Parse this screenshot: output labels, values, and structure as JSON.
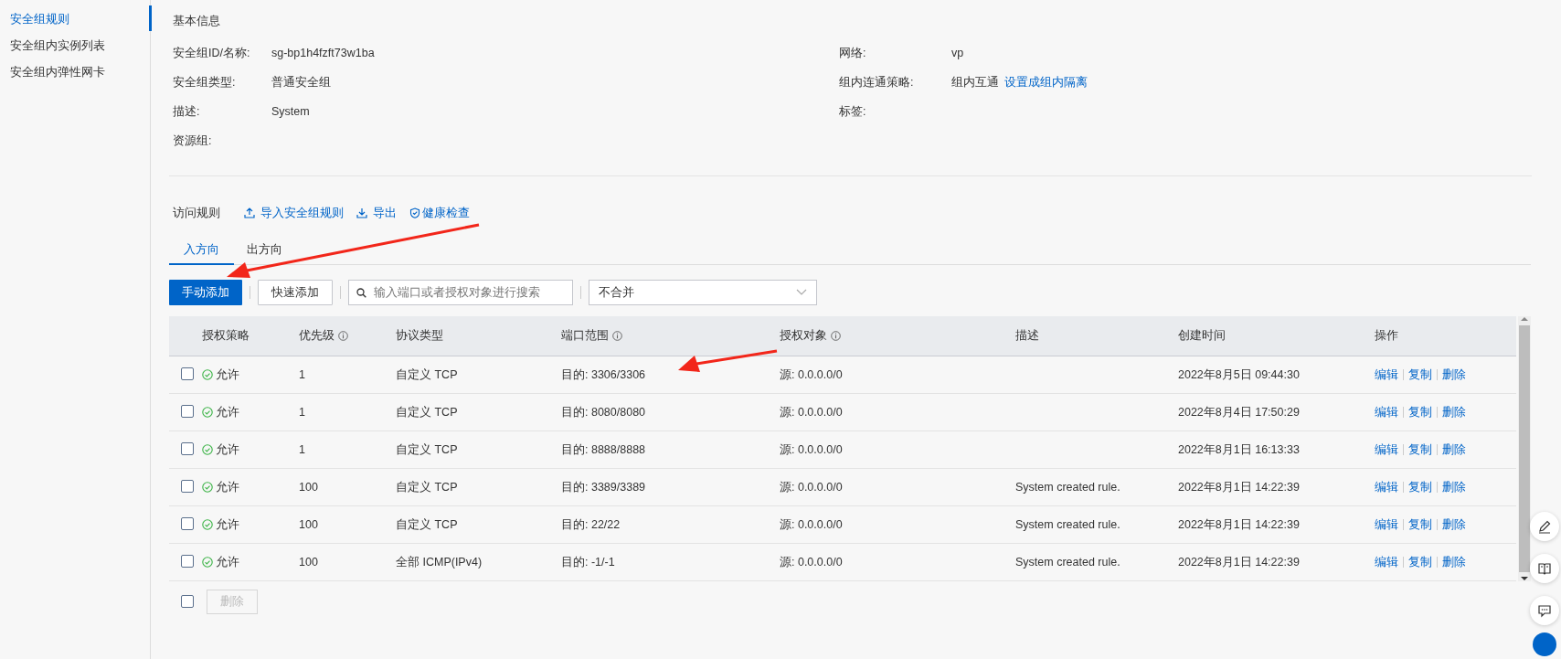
{
  "sidebar": {
    "items": [
      {
        "label": "安全组规则",
        "selected": true
      },
      {
        "label": "安全组内实例列表",
        "selected": false
      },
      {
        "label": "安全组内弹性网卡",
        "selected": false
      }
    ]
  },
  "basic_info": {
    "title": "基本信息",
    "left": [
      {
        "label": "安全组ID/名称:",
        "value": "sg-bp1h4fzft73w1ba"
      },
      {
        "label": "安全组类型:",
        "value": "普通安全组"
      },
      {
        "label": "描述:",
        "value": "System"
      },
      {
        "label": "资源组:"
      }
    ],
    "right": [
      {
        "label": "网络:",
        "value": "vp"
      },
      {
        "label": "组内连通策略:",
        "value": "组内互通",
        "link": "设置成组内隔离"
      },
      {
        "label": "标签:"
      }
    ]
  },
  "access_rules": {
    "title": "访问规则",
    "actions": [
      {
        "label": "导入安全组规则",
        "kind": "upload"
      },
      {
        "label": "导出",
        "kind": "download"
      },
      {
        "label": "健康检查",
        "kind": "shield"
      }
    ]
  },
  "tabs": [
    {
      "label": "入方向",
      "selected": true
    },
    {
      "label": "出方向",
      "selected": false
    }
  ],
  "toolbar": {
    "primary_button": "手动添加",
    "secondary_button": "快速添加",
    "search": {
      "placeholder": "输入端口或者授权对象进行搜索"
    },
    "merge_select": {
      "value": "不合并"
    }
  },
  "table": {
    "columns": [
      {
        "label": "授权策略",
        "info": false
      },
      {
        "label": "优先级",
        "info": true
      },
      {
        "label": "协议类型",
        "info": false
      },
      {
        "label": "端口范围",
        "info": true
      },
      {
        "label": "授权对象",
        "info": true
      },
      {
        "label": "描述",
        "info": false
      },
      {
        "label": "创建时间",
        "info": false
      },
      {
        "label": "操作",
        "info": false
      }
    ],
    "rows": [
      {
        "checked": false,
        "policy": "允许",
        "priority": "1",
        "protocol": "自定义 TCP",
        "port": "目的: 3306/3306",
        "source": "源: 0.0.0.0/0",
        "created": "2022年8月5日 09:44:30",
        "actions": [
          "编辑",
          "复制",
          "删除"
        ]
      },
      {
        "checked": false,
        "policy": "允许",
        "priority": "1",
        "protocol": "自定义 TCP",
        "port": "目的: 8080/8080",
        "source": "源: 0.0.0.0/0",
        "created": "2022年8月4日 17:50:29",
        "actions": [
          "编辑",
          "复制",
          "删除"
        ]
      },
      {
        "checked": false,
        "policy": "允许",
        "priority": "1",
        "protocol": "自定义 TCP",
        "port": "目的: 8888/8888",
        "source": "源: 0.0.0.0/0",
        "created": "2022年8月1日 16:13:33",
        "actions": [
          "编辑",
          "复制",
          "删除"
        ]
      },
      {
        "checked": false,
        "policy": "允许",
        "priority": "100",
        "protocol": "自定义 TCP",
        "port": "目的: 3389/3389",
        "source": "源: 0.0.0.0/0",
        "description": "System created rule.",
        "created": "2022年8月1日 14:22:39",
        "actions": [
          "编辑",
          "复制",
          "删除"
        ]
      },
      {
        "checked": false,
        "policy": "允许",
        "priority": "100",
        "protocol": "自定义 TCP",
        "port": "目的: 22/22",
        "source": "源: 0.0.0.0/0",
        "description": "System created rule.",
        "created": "2022年8月1日 14:22:39",
        "actions": [
          "编辑",
          "复制",
          "删除"
        ]
      },
      {
        "checked": false,
        "policy": "允许",
        "priority": "100",
        "protocol": "全部 ICMP(IPv4)",
        "port": "目的: -1/-1",
        "source": "源: 0.0.0.0/0",
        "description": "System created rule.",
        "created": "2022年8月1日 14:22:39",
        "actions": [
          "编辑",
          "复制",
          "删除"
        ]
      }
    ],
    "footer": {
      "select_all_checked": false,
      "delete_button": {
        "label": "删除",
        "disabled": true
      }
    }
  }
}
